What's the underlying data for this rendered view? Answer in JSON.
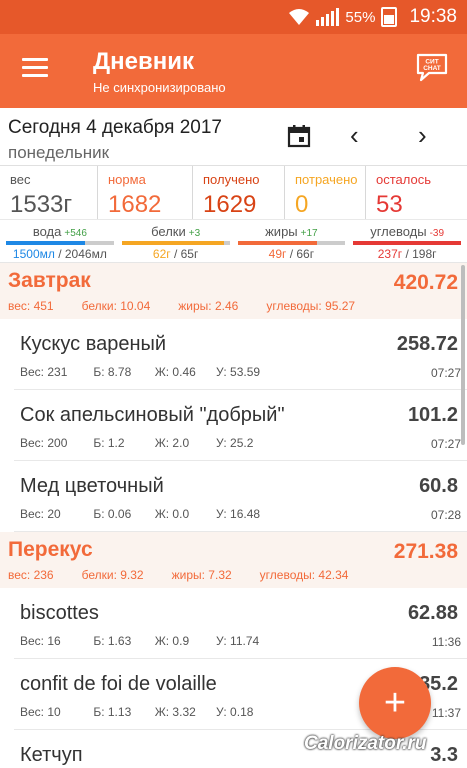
{
  "statusbar": {
    "battery": "55%",
    "time": "19:38"
  },
  "appbar": {
    "title": "Дневник",
    "subtitle": "Не синхронизировано",
    "chat_icon_text": "СИТ CHAT"
  },
  "datebar": {
    "date": "Сегодня 4 декабря 2017",
    "weekday": "понедельник"
  },
  "stats": [
    {
      "label": "вес",
      "value": "1533г",
      "color": "#555555",
      "valcolor": "#555555"
    },
    {
      "label": "норма",
      "value": "1682",
      "color": "#f26a3a",
      "valcolor": "#f26a3a"
    },
    {
      "label": "получено",
      "value": "1629",
      "color": "#d84315",
      "valcolor": "#d84315"
    },
    {
      "label": "потрачено",
      "value": "0",
      "color": "#f5a623",
      "valcolor": "#f5a623"
    },
    {
      "label": "осталось",
      "value": "53",
      "color": "#e53935",
      "valcolor": "#e53935"
    }
  ],
  "macros": [
    {
      "label": "вода",
      "delta": "+546",
      "delta_color": "#43a047",
      "value": "1500мл",
      "total": " / 2046мл",
      "color": "#1e88e5",
      "fill": 0.73
    },
    {
      "label": "белки",
      "delta": "+3",
      "delta_color": "#43a047",
      "value": "62г",
      "total": " / 65г",
      "color": "#f5a623",
      "fill": 0.95
    },
    {
      "label": "жиры",
      "delta": "+17",
      "delta_color": "#43a047",
      "value": "49г",
      "total": " / 66г",
      "color": "#f26a3a",
      "fill": 0.74
    },
    {
      "label": "углеводы",
      "delta": "-39",
      "delta_color": "#e53935",
      "value": "237г",
      "total": " / 198г",
      "color": "#e53935",
      "fill": 1.0
    }
  ],
  "meals": [
    {
      "name": "Завтрак",
      "kcal": "420.72",
      "weight": "вес: 451",
      "protein": "белки: 10.04",
      "fat": "жиры: 2.46",
      "carbs": "углеводы: 95.27",
      "items": [
        {
          "name": "Кускус вареный",
          "kcal": "258.72",
          "w": "Вес: 231",
          "p": "Б: 8.78",
          "f": "Ж: 0.46",
          "c": "У: 53.59",
          "time": "07:27"
        },
        {
          "name": "Сок апельсиновый \"добрый\"",
          "kcal": "101.2",
          "w": "Вес: 200",
          "p": "Б: 1.2",
          "f": "Ж: 2.0",
          "c": "У: 25.2",
          "time": "07:27"
        },
        {
          "name": "Мед цветочный",
          "kcal": "60.8",
          "w": "Вес: 20",
          "p": "Б: 0.06",
          "f": "Ж: 0.0",
          "c": "У: 16.48",
          "time": "07:28"
        }
      ]
    },
    {
      "name": "Перекус",
      "kcal": "271.38",
      "weight": "вес: 236",
      "protein": "белки: 9.32",
      "fat": "жиры: 7.32",
      "carbs": "углеводы: 42.34",
      "items": [
        {
          "name": "biscottes",
          "kcal": "62.88",
          "w": "Вес: 16",
          "p": "Б: 1.63",
          "f": "Ж: 0.9",
          "c": "У: 11.74",
          "time": "11:36"
        },
        {
          "name": "confit de foi de volaille",
          "kcal": "35.2",
          "w": "Вес: 10",
          "p": "Б: 1.13",
          "f": "Ж: 3.32",
          "c": "У: 0.18",
          "time": "11:37"
        },
        {
          "name": "Кетчуп",
          "kcal": "3.3",
          "w": "",
          "p": "",
          "f": "",
          "c": "",
          "time": ""
        }
      ]
    }
  ],
  "fab": {
    "label": "+"
  },
  "watermark": "Calorizator.ru"
}
